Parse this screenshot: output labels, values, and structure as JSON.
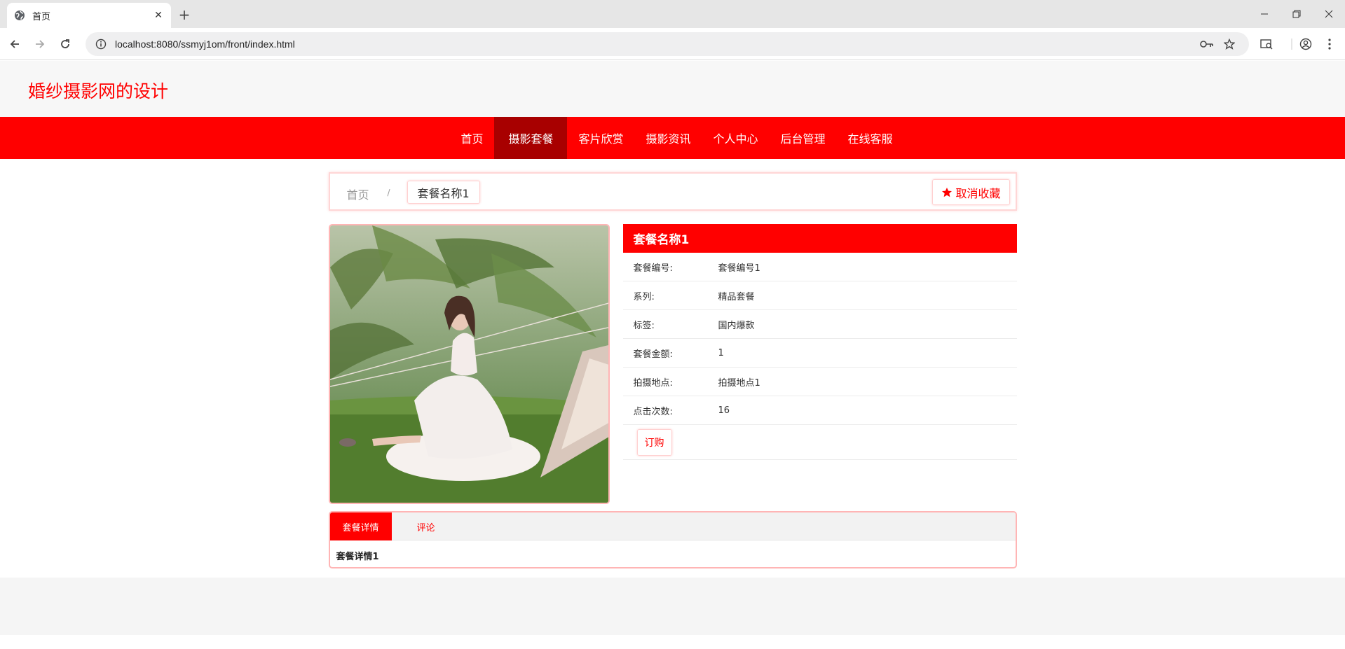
{
  "browser": {
    "tab_title": "首页",
    "url": "localhost:8080/ssmyj1om/front/index.html"
  },
  "site": {
    "title": "婚纱摄影网的设计"
  },
  "nav": {
    "items": [
      "首页",
      "摄影套餐",
      "客片欣赏",
      "摄影资讯",
      "个人中心",
      "后台管理",
      "在线客服"
    ],
    "active_index": 1
  },
  "breadcrumb": {
    "home": "首页",
    "separator": "/",
    "current": "套餐名称1"
  },
  "favorite": {
    "label": "取消收藏"
  },
  "package": {
    "name": "套餐名称1",
    "fields": [
      {
        "label": "套餐编号:",
        "value": "套餐编号1"
      },
      {
        "label": "系列:",
        "value": "精品套餐"
      },
      {
        "label": "标签:",
        "value": "国内爆款"
      },
      {
        "label": "套餐金额:",
        "value": "1"
      },
      {
        "label": "拍摄地点:",
        "value": "拍摄地点1"
      },
      {
        "label": "点击次数:",
        "value": "16"
      }
    ],
    "order_label": "订购"
  },
  "detail": {
    "tabs": [
      "套餐详情",
      "评论"
    ],
    "body": "套餐详情1"
  },
  "colors": {
    "accent": "#ff0000",
    "nav_active": "#a80000"
  }
}
